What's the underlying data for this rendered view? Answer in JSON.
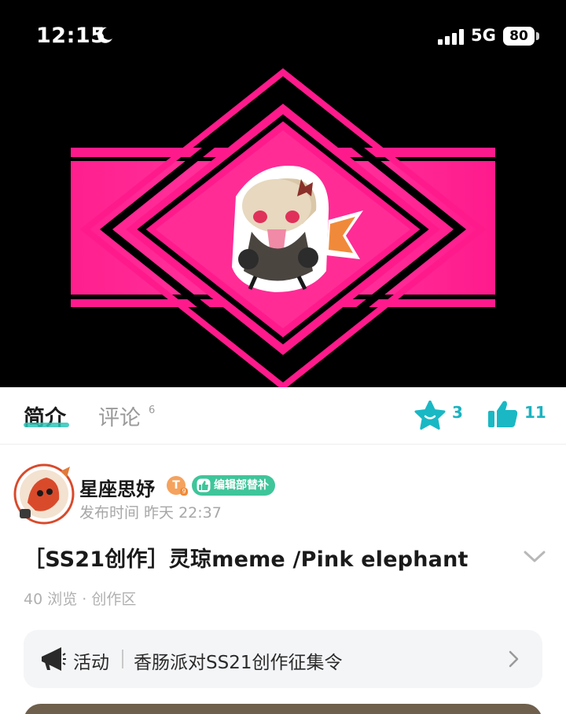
{
  "status_bar": {
    "time": "12:15",
    "network": "5G",
    "battery": "80"
  },
  "video": {
    "content": "pink diamond banner with chibi character"
  },
  "tabs": {
    "intro_label": "简介",
    "comments_label": "评论",
    "comments_count": "6"
  },
  "reactions": {
    "favorites": "3",
    "likes": "11"
  },
  "author": {
    "name": "星座思妤",
    "level": "T",
    "level_sub": "9",
    "role": "编辑部替补",
    "post_time": "发布时间 昨天 22:37"
  },
  "post": {
    "title": "［SS21创作］灵琼meme /Pink elephant",
    "stats": "40 浏览 · 创作区"
  },
  "activity": {
    "label": "活动",
    "text": "香肠派对SS21创作征集令"
  },
  "colors": {
    "accent": "#2ec4b6",
    "count_color": "#1bb3c0",
    "banner_pink": "#ff1a8c",
    "role_badge": "#3fc59a",
    "level_badge": "#f5a25d"
  }
}
